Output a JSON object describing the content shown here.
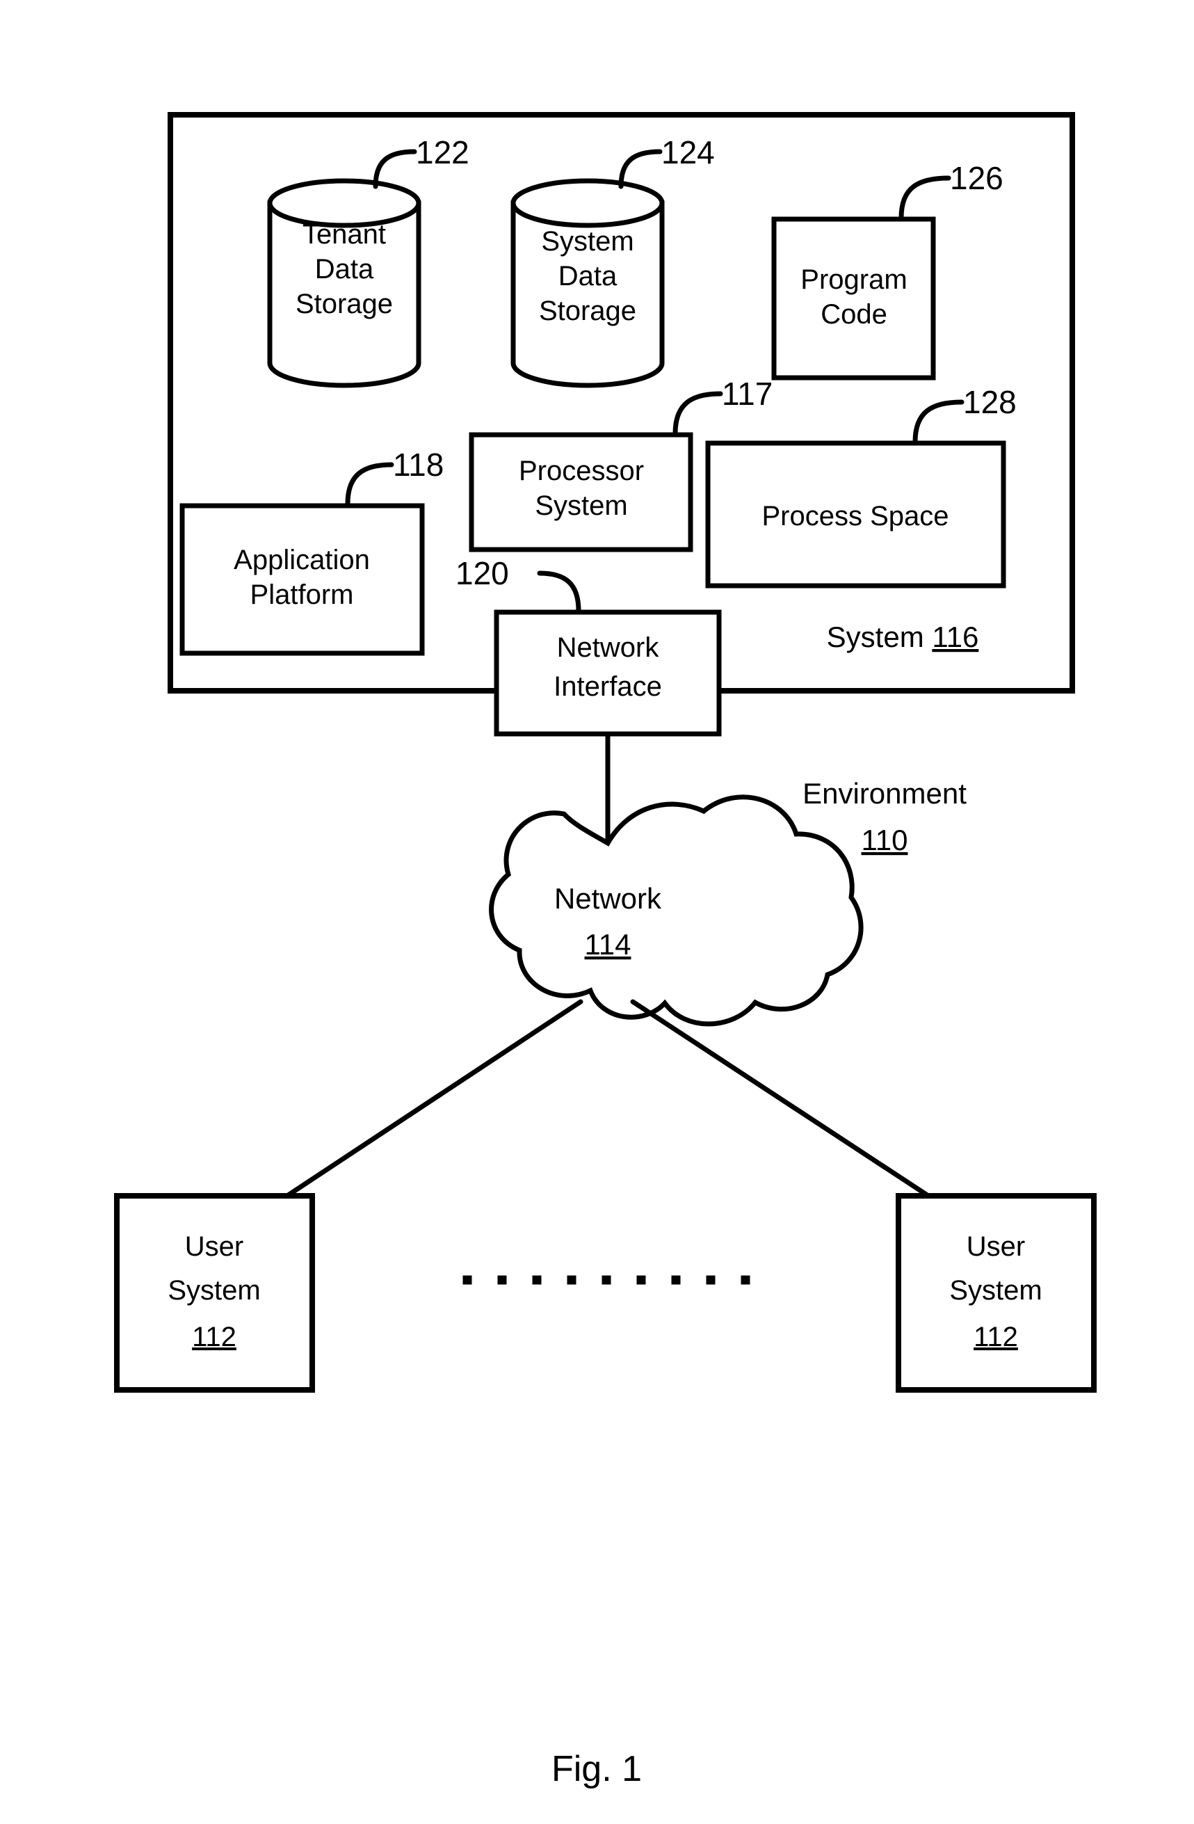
{
  "figure": {
    "caption": "Fig. 1",
    "system_box": {
      "label_text": "System",
      "label_ref": "116"
    },
    "environment": {
      "label_text": "Environment",
      "label_ref": "110"
    }
  },
  "nodes": {
    "tenant_data_storage": {
      "shape": "cylinder",
      "lines": [
        "Tenant",
        "Data",
        "Storage"
      ],
      "ref": "122"
    },
    "system_data_storage": {
      "shape": "cylinder",
      "lines": [
        "System",
        "Data",
        "Storage"
      ],
      "ref": "124"
    },
    "program_code": {
      "shape": "rect",
      "lines": [
        "Program",
        "Code"
      ],
      "ref": "126"
    },
    "processor_system": {
      "shape": "rect",
      "lines": [
        "Processor",
        "System"
      ],
      "ref": "117"
    },
    "process_space": {
      "shape": "rect",
      "lines": [
        "Process Space"
      ],
      "ref": "128"
    },
    "application_platform": {
      "shape": "rect",
      "lines": [
        "Application",
        "Platform"
      ],
      "ref": "118"
    },
    "network_interface": {
      "shape": "rect",
      "lines": [
        "Network",
        "Interface"
      ],
      "ref": "120"
    },
    "network_cloud": {
      "shape": "cloud",
      "label_text": "Network",
      "label_ref": "114"
    },
    "user_system_left": {
      "shape": "rect",
      "lines": [
        "User",
        "System"
      ],
      "ref": "112"
    },
    "user_system_right": {
      "shape": "rect",
      "lines": [
        "User",
        "System"
      ],
      "ref": "112"
    }
  },
  "ellipsis": {
    "dot_count": 9,
    "symbol": "."
  },
  "colors": {
    "stroke": "#000000",
    "fill": "#ffffff",
    "background": "#ffffff"
  }
}
